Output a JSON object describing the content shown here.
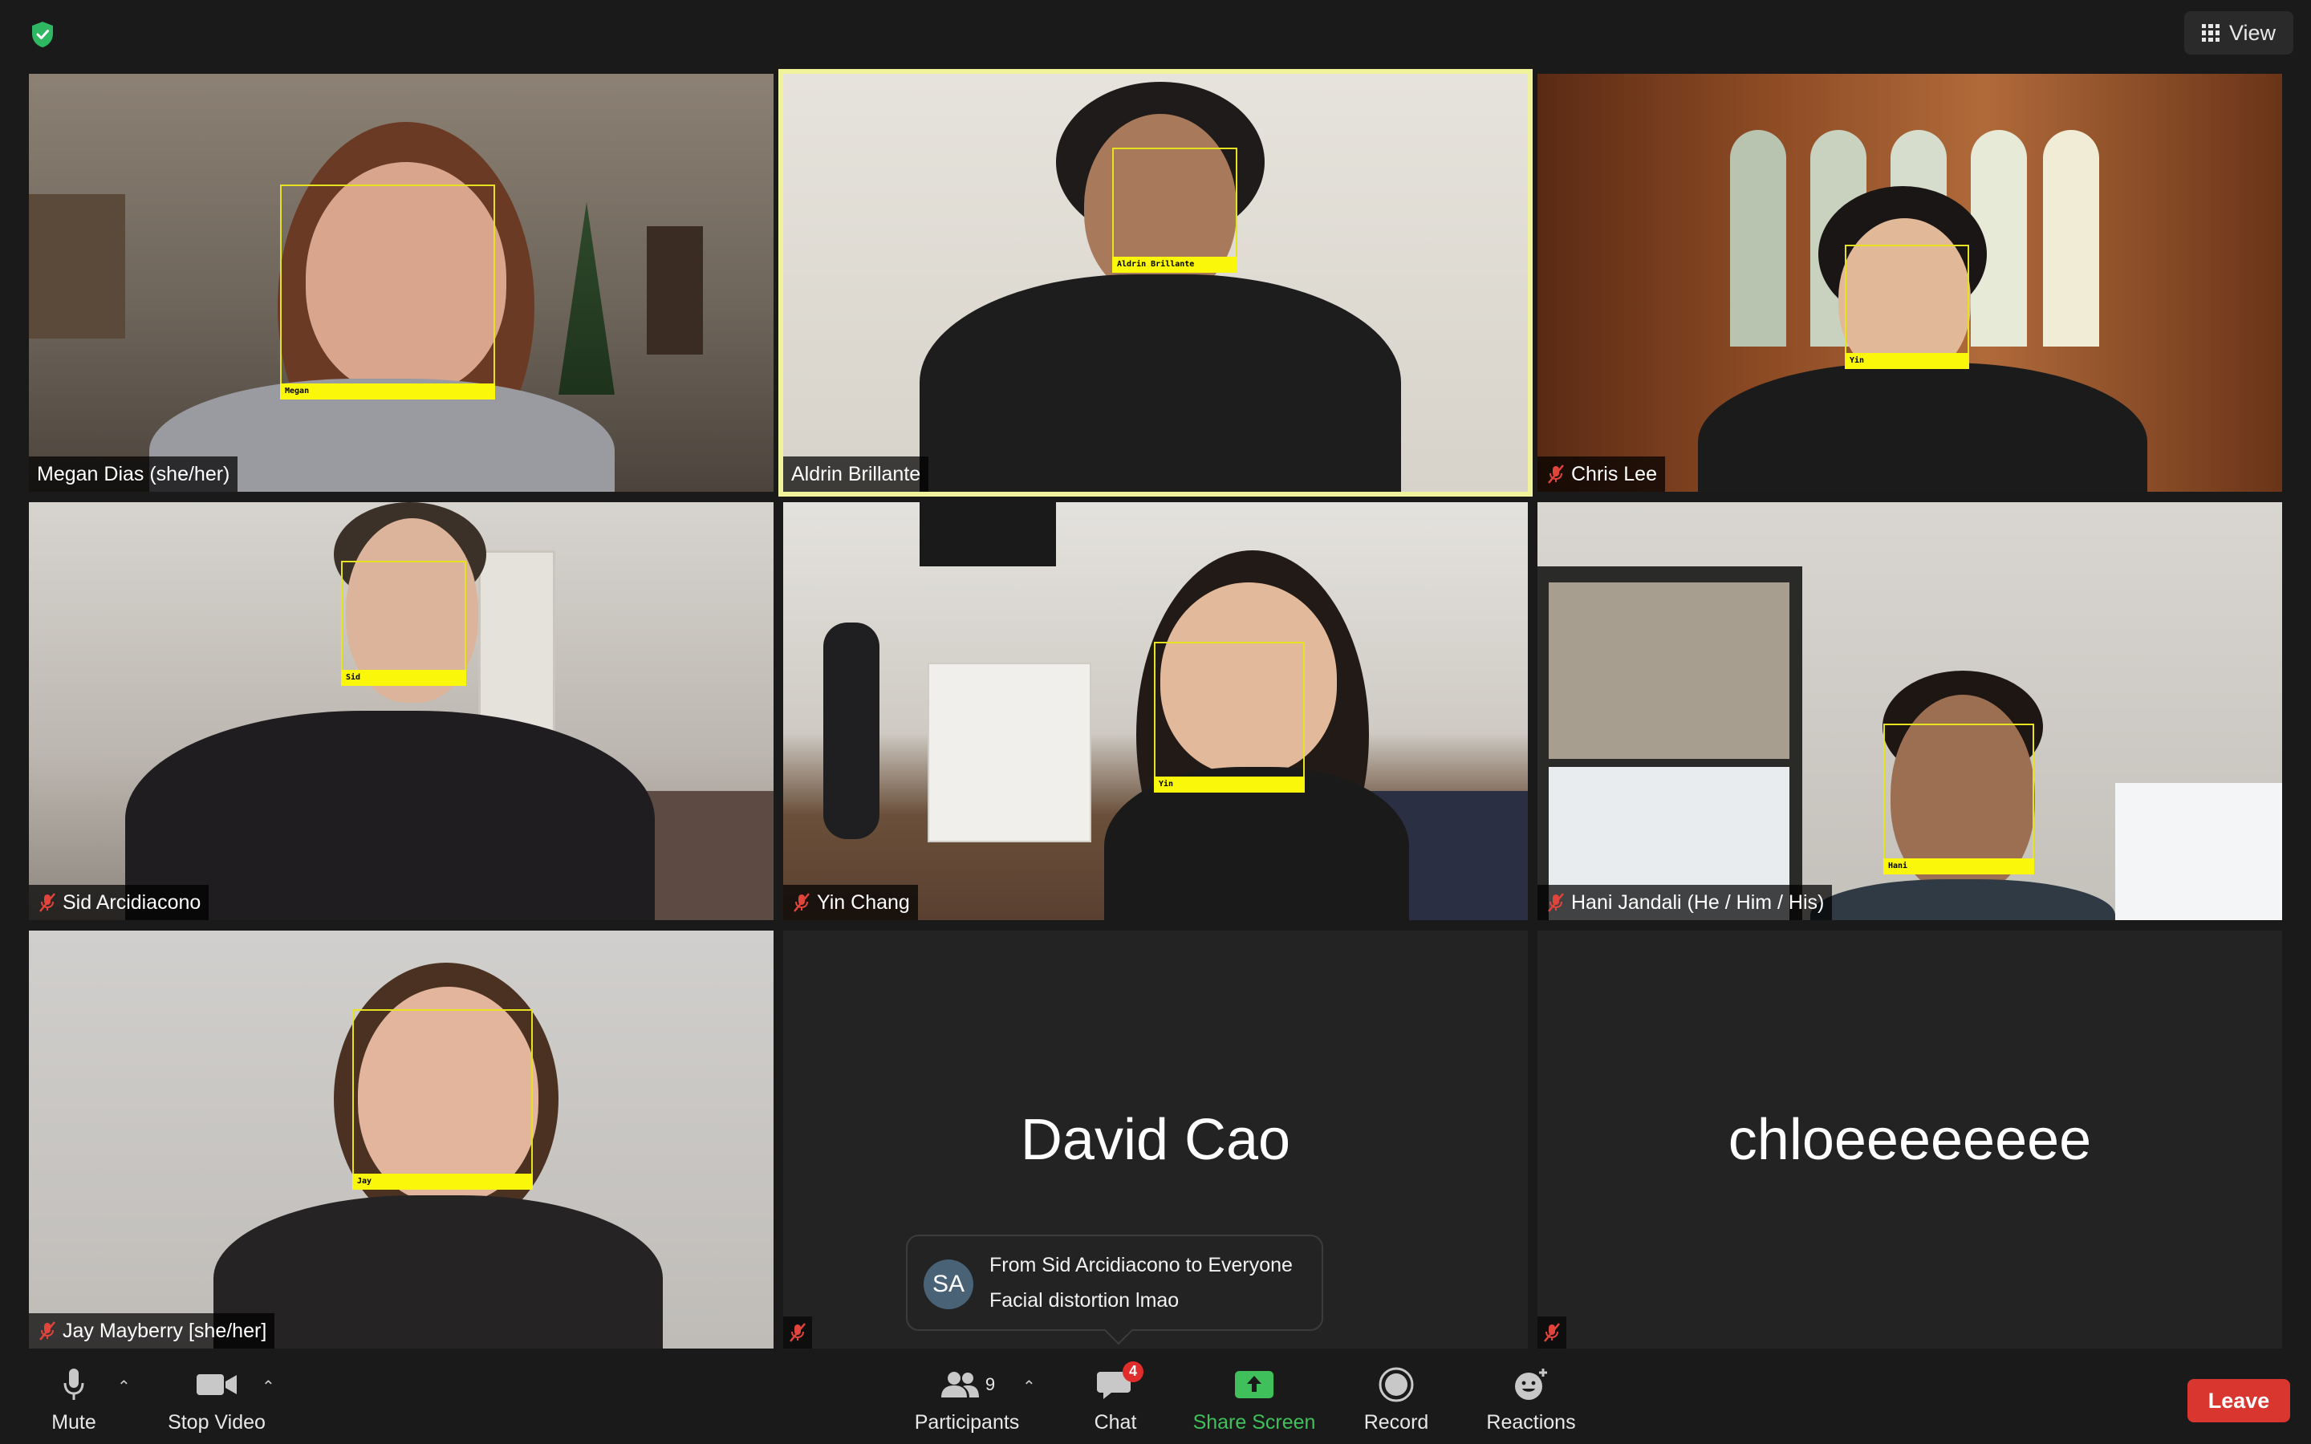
{
  "top_bar": {
    "view_label": "View"
  },
  "participants": [
    {
      "name": "Megan Dias (she/her)",
      "face_tag": "Megan",
      "muted": false
    },
    {
      "name": "Aldrin Brillante",
      "face_tag": "Aldrin Brillante",
      "muted": false,
      "active_speaker": true
    },
    {
      "name": "Chris Lee",
      "face_tag": "Yin",
      "muted": true
    },
    {
      "name": "Sid Arcidiacono",
      "face_tag": "Sid",
      "muted": true
    },
    {
      "name": "Yin Chang",
      "face_tag": "Yin",
      "muted": true
    },
    {
      "name": "Hani Jandali (He / Him / His)",
      "face_tag": "Hani",
      "muted": true
    },
    {
      "name": "Jay Mayberry [she/her]",
      "face_tag": "Jay",
      "muted": true
    },
    {
      "name": "David Cao",
      "muted": true,
      "video_off": true
    },
    {
      "name": "chloeeeeeeee",
      "muted": true,
      "video_off": true
    }
  ],
  "chat_toast": {
    "avatar_initials": "SA",
    "from": "From Sid Arcidiacono to Everyone",
    "message": "Facial distortion lmao"
  },
  "toolbar": {
    "mute": "Mute",
    "stop_video": "Stop Video",
    "participants": "Participants",
    "participants_count": "9",
    "chat": "Chat",
    "chat_badge": "4",
    "share_screen": "Share Screen",
    "record": "Record",
    "reactions": "Reactions",
    "leave": "Leave"
  },
  "colors": {
    "background": "#1a1a1a",
    "active_speaker_border": "#f1f39b",
    "face_box": "#fbf70b",
    "share_green": "#3fc05a",
    "leave_red": "#d9362f",
    "muted_red": "#e0443a"
  }
}
